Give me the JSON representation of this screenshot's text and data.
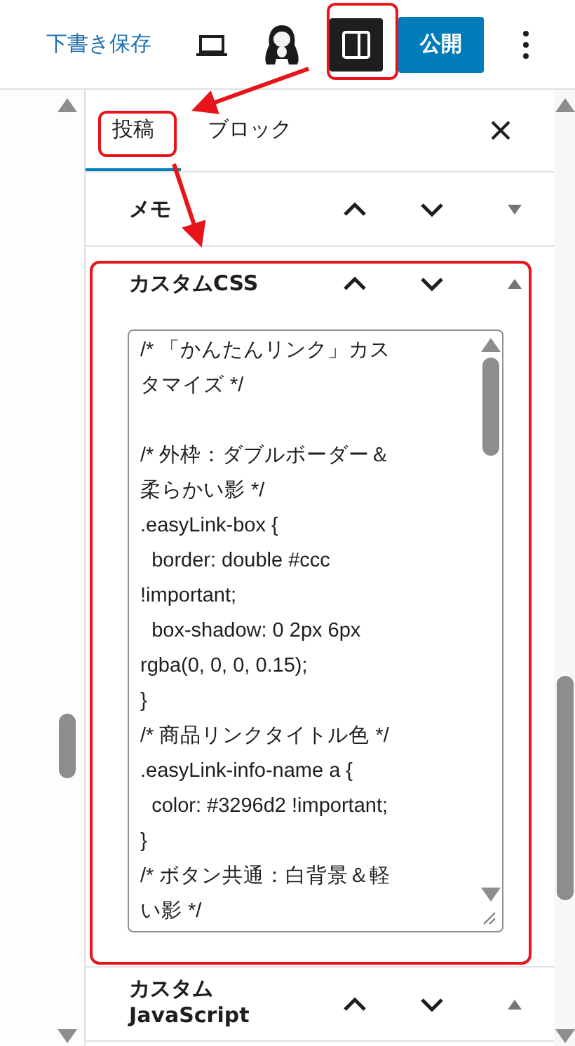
{
  "toolbar": {
    "save_draft": "下書き保存",
    "publish": "公開",
    "sidebar_toggle": {
      "pressed": true
    }
  },
  "sidebar": {
    "tabs": [
      {
        "label": "投稿",
        "selected": true
      },
      {
        "label": "ブロック",
        "selected": false
      }
    ]
  },
  "panels": [
    {
      "title": "メモ",
      "expanded": false
    },
    {
      "title": "カスタムCSS",
      "expanded": true,
      "code": "/* 「かんたんリンク」カスタマイズ */\n\n/* 外枠：ダブルボーダー＆柔らかい影 */\n.easyLink-box {\n  border: double #ccc !important;\n  box-shadow: 0 2px 6px rgba(0, 0, 0, 0.15);\n}\n/* 商品リンクタイトル色 */\n.easyLink-info-name a {\n  color: #3296d2 !important;\n}\n/* ボタン共通：白背景＆軽い影 */"
    },
    {
      "title": "カスタム JavaScript",
      "expanded": true
    }
  ]
}
